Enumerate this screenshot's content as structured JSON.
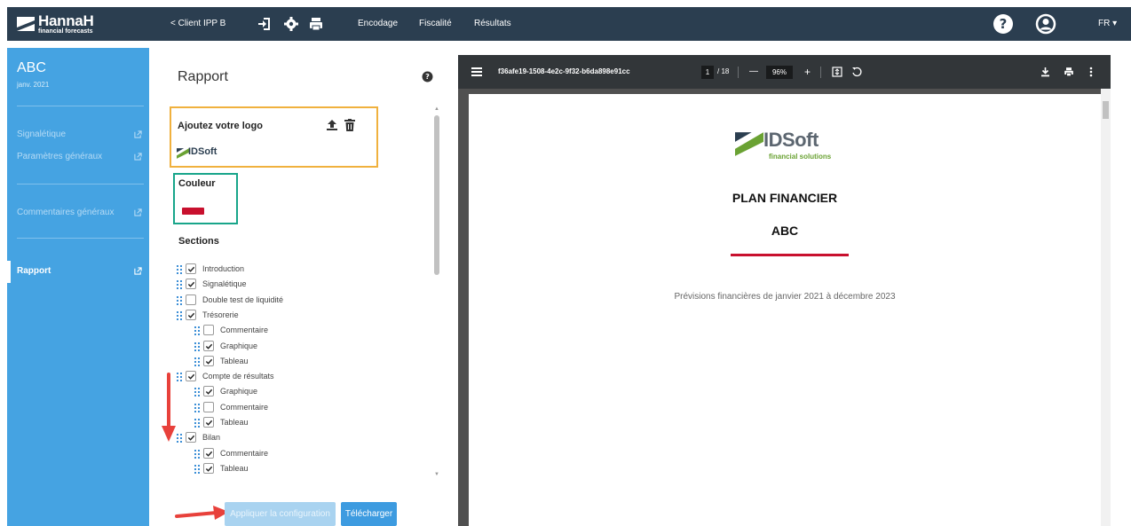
{
  "app": {
    "brand": "HannaH",
    "tagline": "financial forecasts"
  },
  "topbar": {
    "back_label": "< Client IPP B",
    "nav": [
      "Encodage",
      "Fiscalité",
      "Résultats"
    ],
    "lang": "FR ▾"
  },
  "icons": {
    "login": "login-icon",
    "settings": "gear-icon",
    "print": "print-icon",
    "help": "help-icon",
    "account": "user-icon",
    "upload": "upload-icon",
    "trash": "trash-icon",
    "external": "external-link-icon",
    "drag": "drag-handle-icon"
  },
  "sidebar": {
    "title": "ABC",
    "subtitle": "janv. 2021",
    "items": [
      {
        "label": "Signalétique"
      },
      {
        "label": "Paramètres généraux"
      },
      {
        "label": "Commentaires généraux"
      },
      {
        "label": "Rapport"
      }
    ]
  },
  "report": {
    "title": "Rapport",
    "logo_section": {
      "label": "Ajoutez votre logo",
      "preview_text": "IDSoft"
    },
    "color_section": {
      "label": "Couleur",
      "value": "#c8102e"
    },
    "sections_label": "Sections",
    "sections": [
      {
        "label": "Introduction",
        "checked": true,
        "level": 0
      },
      {
        "label": "Signalétique",
        "checked": true,
        "level": 0
      },
      {
        "label": "Double test de liquidité",
        "checked": false,
        "level": 0
      },
      {
        "label": "Trésorerie",
        "checked": true,
        "level": 0
      },
      {
        "label": "Commentaire",
        "checked": false,
        "level": 1
      },
      {
        "label": "Graphique",
        "checked": true,
        "level": 1
      },
      {
        "label": "Tableau",
        "checked": true,
        "level": 1
      },
      {
        "label": "Compte de résultats",
        "checked": true,
        "level": 0
      },
      {
        "label": "Graphique",
        "checked": true,
        "level": 1
      },
      {
        "label": "Commentaire",
        "checked": false,
        "level": 1
      },
      {
        "label": "Tableau",
        "checked": true,
        "level": 1
      },
      {
        "label": "Bilan",
        "checked": true,
        "level": 0
      },
      {
        "label": "Commentaire",
        "checked": true,
        "level": 1
      },
      {
        "label": "Tableau",
        "checked": true,
        "level": 1
      }
    ],
    "apply_label": "Appliquer la configuration",
    "download_label": "Télécharger"
  },
  "viewer": {
    "filename": "f36afe19-1508-4e2c-9f32-b6da898e91cc",
    "page_current": "1",
    "page_total": "/ 18",
    "zoom": "96%",
    "zoom_out": "—",
    "zoom_in": "+",
    "document": {
      "logo_name": "IDSoft",
      "logo_tagline": "financial solutions",
      "title": "PLAN FINANCIER",
      "company": "ABC",
      "subtitle": "Prévisions financières de janvier 2021 à décembre 2023"
    }
  },
  "colors": {
    "topbar": "#2b3e50",
    "sidebar": "#45a3e2",
    "accent": "#c8102e",
    "logo_box": "#f0b13e",
    "color_box": "#18a58a",
    "primary_button": "#3d9be0"
  }
}
